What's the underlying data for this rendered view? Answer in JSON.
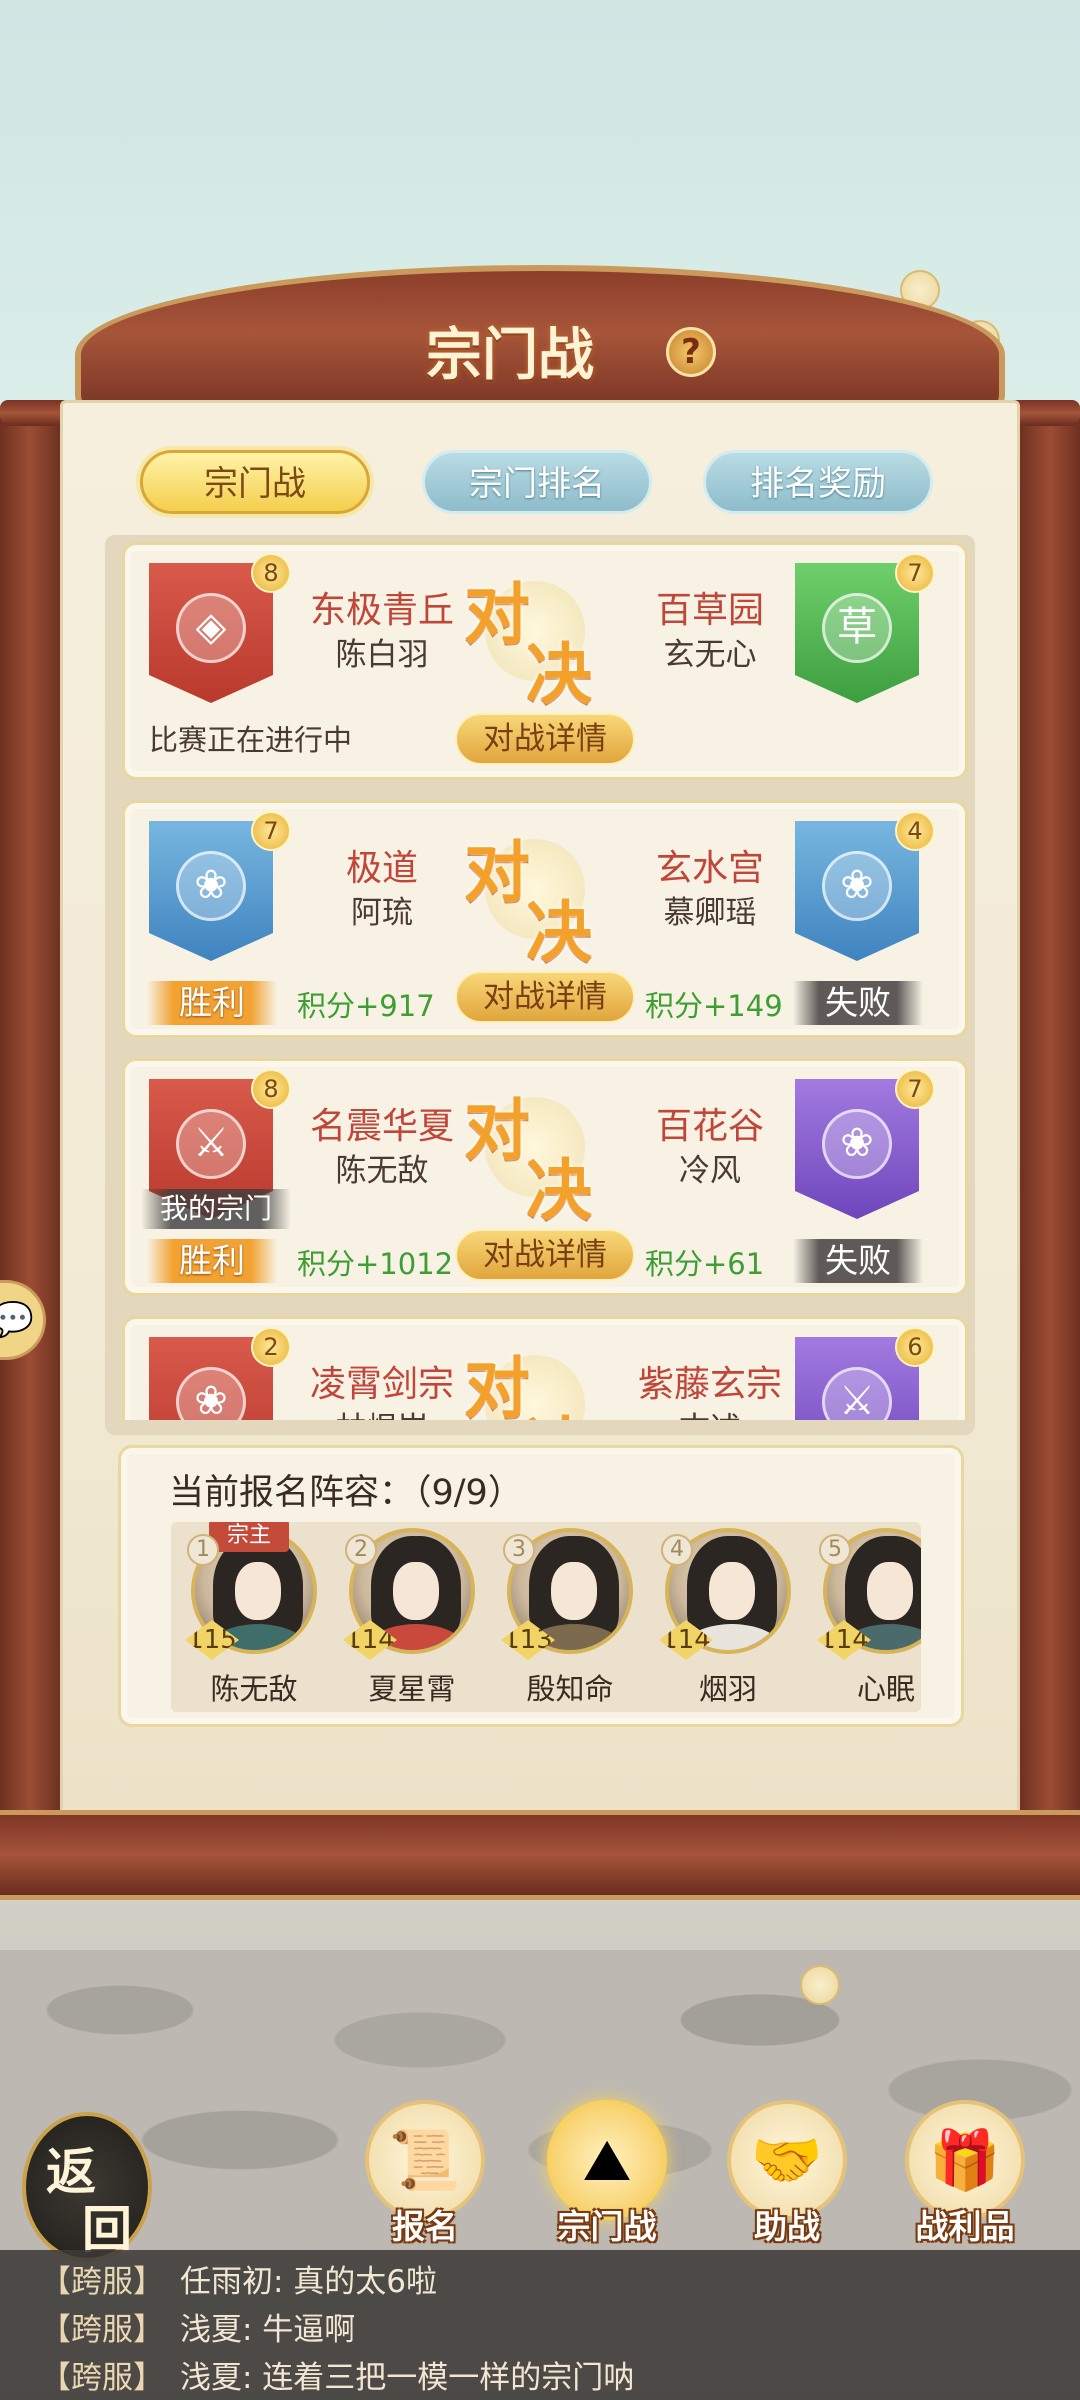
{
  "title": "宗门战",
  "help_icon": "question-icon",
  "tabs": [
    {
      "label": "宗门战",
      "active": true
    },
    {
      "label": "宗门排名",
      "active": false
    },
    {
      "label": "排名奖励",
      "active": false
    }
  ],
  "vs_chars": [
    "对",
    "决"
  ],
  "detail_label": "对战详情",
  "matches": [
    {
      "left": {
        "name": "东极青丘",
        "leader": "陈白羽",
        "level": "8",
        "banner_color": "#d1503f",
        "emblem": "coin-icon",
        "emblem_glyph": "◈"
      },
      "right": {
        "name": "百草园",
        "leader": "玄无心",
        "level": "7",
        "banner_color": "#56b553",
        "emblem": "herb-icon",
        "emblem_glyph": "草"
      },
      "status": "比赛正在进行中"
    },
    {
      "left": {
        "name": "极道",
        "leader": "阿琉",
        "level": "7",
        "banner_color": "#5a9ed3",
        "emblem": "lotus-icon",
        "emblem_glyph": "❀",
        "result": "胜利",
        "score": "积分+917"
      },
      "right": {
        "name": "玄水宫",
        "leader": "慕卿瑶",
        "level": "4",
        "banner_color": "#5a9ed3",
        "emblem": "lotus-icon",
        "emblem_glyph": "❀",
        "result": "失败",
        "score": "积分+149"
      }
    },
    {
      "left": {
        "name": "名震华夏",
        "leader": "陈无敌",
        "level": "8",
        "banner_color": "#d1503f",
        "emblem": "crossed-swords-icon",
        "emblem_glyph": "⚔",
        "result": "胜利",
        "score": "积分+1012",
        "my_sect_tag": "我的宗门"
      },
      "right": {
        "name": "百花谷",
        "leader": "冷风",
        "level": "7",
        "banner_color": "#8c63cf",
        "emblem": "lotus-icon",
        "emblem_glyph": "❀",
        "result": "失败",
        "score": "积分+61"
      }
    },
    {
      "left": {
        "name": "凌霄剑宗",
        "leader": "林焜岚",
        "level": "2",
        "banner_color": "#d1503f",
        "emblem": "lotus-icon",
        "emblem_glyph": "❀"
      },
      "right": {
        "name": "紫藤玄宗",
        "leader": "古述",
        "level": "6",
        "banner_color": "#8c63cf",
        "emblem": "crossed-swords-icon",
        "emblem_glyph": "⚔"
      }
    }
  ],
  "lineup": {
    "title": "当前报名阵容：（9/9）",
    "leader_tag": "宗主",
    "members": [
      {
        "index": "1",
        "level": "115",
        "name": "陈无敌",
        "robe": "#3e6d6a"
      },
      {
        "index": "2",
        "level": "114",
        "name": "夏星霄",
        "robe": "#c94a3d"
      },
      {
        "index": "3",
        "level": "113",
        "name": "殷知命",
        "robe": "#7b6a4d"
      },
      {
        "index": "4",
        "level": "114",
        "name": "烟羽",
        "robe": "#e9e4dc"
      },
      {
        "index": "5",
        "level": "114",
        "name": "心眠",
        "robe": "#4b6a6b"
      }
    ]
  },
  "back_button": [
    "返",
    "回"
  ],
  "nav": [
    {
      "label": "报名",
      "icon": "scroll-brush-icon",
      "glyph": "📜",
      "active": false
    },
    {
      "label": "宗门战",
      "icon": "flag-mountain-icon",
      "glyph": "⛰",
      "active": true
    },
    {
      "label": "助战",
      "icon": "handshake-icon",
      "glyph": "🤝",
      "active": false
    },
    {
      "label": "战利品",
      "icon": "treasure-chest-icon",
      "glyph": "🎁",
      "active": false
    }
  ],
  "chat": [
    {
      "tag": "【跨服】",
      "name": "任雨初",
      "message": ": 真的太6啦"
    },
    {
      "tag": "【跨服】",
      "name": "浅夏",
      "message": ": 牛逼啊"
    },
    {
      "tag": "【跨服】",
      "name": "浅夏",
      "message": ": 连着三把一模一样的宗门呐"
    }
  ]
}
